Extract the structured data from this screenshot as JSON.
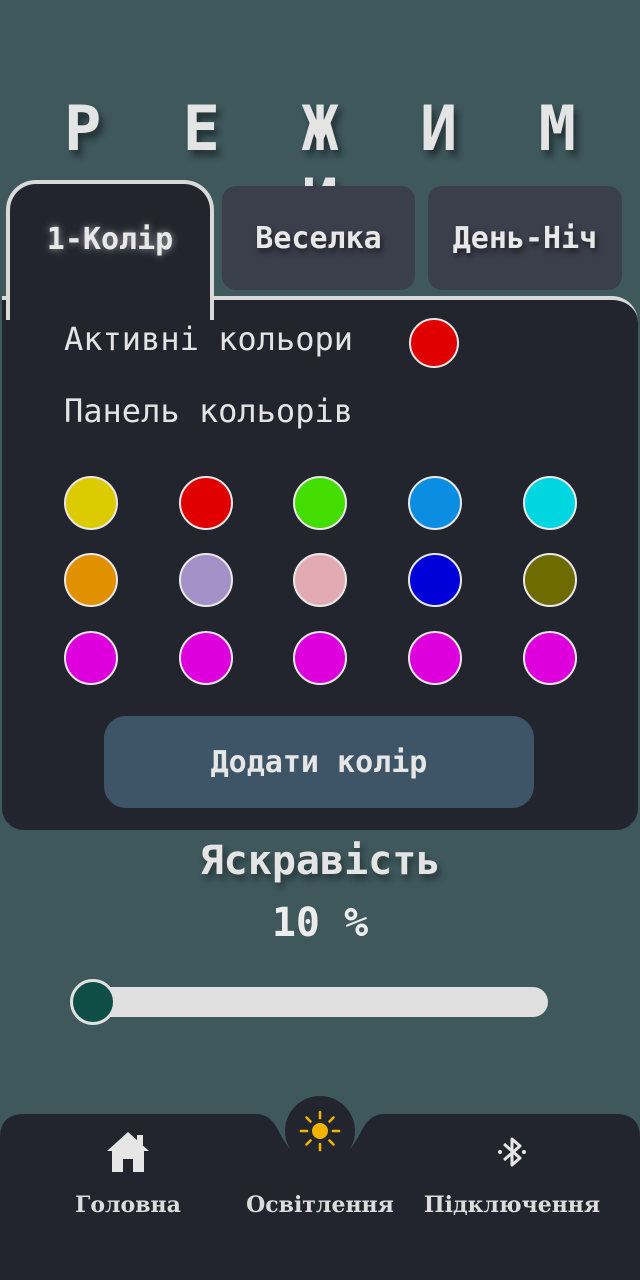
{
  "title": "Р Е Ж И М И",
  "tabs": [
    {
      "label": "1-Колір",
      "active": true
    },
    {
      "label": "Веселка",
      "active": false
    },
    {
      "label": "День-Ніч",
      "active": false
    }
  ],
  "panel": {
    "active_colors_label": "Активні кольори",
    "active_color": "#e00000",
    "palette_label": "Панель кольорів",
    "palette": [
      [
        "#dccb00",
        "#e00000",
        "#44dd00",
        "#0b8de2",
        "#00d6e0"
      ],
      [
        "#e19000",
        "#a390c6",
        "#e2aab3",
        "#0000d8",
        "#6e6b00"
      ],
      [
        "#dd00dd",
        "#dd00dd",
        "#dd00dd",
        "#dd00dd",
        "#dd00dd"
      ]
    ],
    "add_button_label": "Додати колір"
  },
  "brightness": {
    "title": "Яскравість",
    "value_text": "10 %",
    "value": 10
  },
  "bottom_nav": {
    "items": [
      {
        "label": "Головна",
        "icon": "home-icon"
      },
      {
        "label": "Освітлення",
        "icon": "sun-icon",
        "active": true
      },
      {
        "label": "Підключення",
        "icon": "bluetooth-icon"
      }
    ]
  },
  "colors": {
    "background": "#3e585c",
    "panel": "#23252e",
    "accent_sun": "#f0b400",
    "slider_thumb": "#0f4d47"
  }
}
